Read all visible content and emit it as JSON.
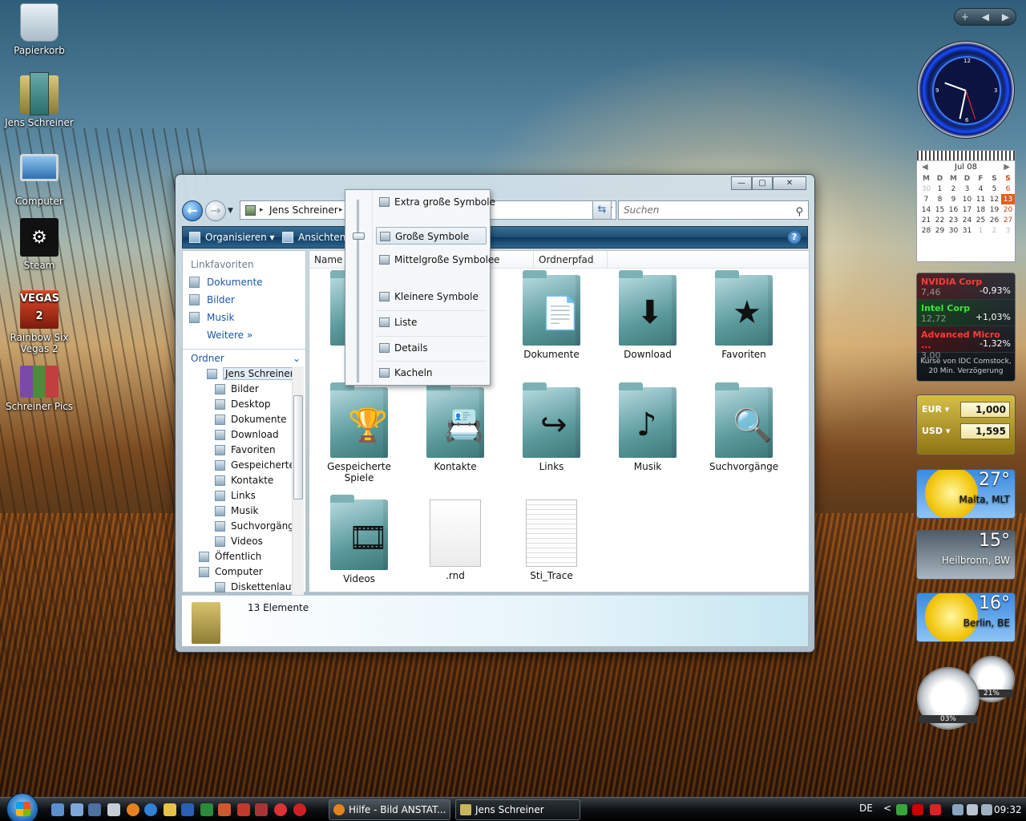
{
  "desktop": {
    "icons": [
      {
        "label": "Papierkorb"
      },
      {
        "label": "Jens Schreiner"
      },
      {
        "label": "Computer"
      },
      {
        "label": "Steam"
      },
      {
        "label": "Rainbow Six Vegas 2"
      },
      {
        "label": "Schreiner Pics"
      }
    ],
    "vegas_logo": "VEGAS 2"
  },
  "explorer": {
    "window_buttons": {
      "min": "—",
      "max": "▢",
      "close": "✕"
    },
    "address": {
      "path": "Jens Schreiner",
      "sep": "▸"
    },
    "search": {
      "placeholder": "Suchen"
    },
    "toolbar": {
      "organize": "Organisieren",
      "views": "Ansichten",
      "help": "?"
    },
    "favorites": {
      "header": "Linkfavoriten",
      "items": [
        "Dokumente",
        "Bilder",
        "Musik"
      ],
      "more": "Weitere"
    },
    "folders": {
      "header": "Ordner",
      "tree": [
        {
          "label": "Jens Schreiner",
          "indent": 0,
          "selected": true
        },
        {
          "label": "Bilder",
          "indent": 1
        },
        {
          "label": "Desktop",
          "indent": 1
        },
        {
          "label": "Dokumente",
          "indent": 1
        },
        {
          "label": "Download",
          "indent": 1
        },
        {
          "label": "Favoriten",
          "indent": 1
        },
        {
          "label": "Gespeicherte S",
          "indent": 1
        },
        {
          "label": "Kontakte",
          "indent": 1
        },
        {
          "label": "Links",
          "indent": 1
        },
        {
          "label": "Musik",
          "indent": 1
        },
        {
          "label": "Suchvorgänge",
          "indent": 1
        },
        {
          "label": "Videos",
          "indent": 1
        },
        {
          "label": "Öffentlich",
          "indent": -1
        },
        {
          "label": "Computer",
          "indent": -1
        },
        {
          "label": "Diskettenlaufw",
          "indent": 1
        }
      ]
    },
    "columns": {
      "name": "Name",
      "partial": "e",
      "path": "Ordnerpfad"
    },
    "items": [
      {
        "label": "B",
        "kind": "folder",
        "emblem": ""
      },
      {
        "label": "Dokumente",
        "kind": "folder",
        "emblem": "📄"
      },
      {
        "label": "Download",
        "kind": "folder",
        "emblem": "⬇"
      },
      {
        "label": "Favoriten",
        "kind": "folder",
        "emblem": "★"
      },
      {
        "label": "Gespeicherte Spiele",
        "kind": "folder",
        "emblem": "🏆"
      },
      {
        "label": "Kontakte",
        "kind": "folder",
        "emblem": "📇"
      },
      {
        "label": "Links",
        "kind": "folder",
        "emblem": "↪"
      },
      {
        "label": "Musik",
        "kind": "folder",
        "emblem": "♪"
      },
      {
        "label": "Suchvorgänge",
        "kind": "folder",
        "emblem": "🔍"
      },
      {
        "label": "Videos",
        "kind": "folder",
        "emblem": "🎞"
      },
      {
        "label": ".rnd",
        "kind": "file"
      },
      {
        "label": "Sti_Trace",
        "kind": "text"
      }
    ],
    "status": {
      "count": "13 Elemente"
    }
  },
  "view_menu": {
    "items": [
      "Extra große Symbole",
      "Große Symbole",
      "Mittelgroße Symbole",
      "Kleinere Symbole",
      "Liste",
      "Details",
      "Kacheln"
    ],
    "selected": "Große Symbole"
  },
  "gadgets": {
    "nav": {
      "add": "+",
      "prev": "◀",
      "next": "▶"
    },
    "calendar": {
      "month": "Jul 08",
      "prev": "◀",
      "next": "▶",
      "weekdays": [
        "M",
        "D",
        "M",
        "D",
        "F",
        "S",
        "S"
      ],
      "weeks": [
        [
          "30",
          "1",
          "2",
          "3",
          "4",
          "5",
          "6"
        ],
        [
          "7",
          "8",
          "9",
          "10",
          "11",
          "12",
          "13"
        ],
        [
          "14",
          "15",
          "16",
          "17",
          "18",
          "19",
          "20"
        ],
        [
          "21",
          "22",
          "23",
          "24",
          "25",
          "26",
          "27"
        ],
        [
          "28",
          "29",
          "30",
          "31",
          "1",
          "2",
          "3"
        ]
      ],
      "today": "13"
    },
    "stocks": {
      "items": [
        {
          "name": "NVIDIA Corp",
          "price": "7,46",
          "change": "-0,93%",
          "trend": "down"
        },
        {
          "name": "Intel Corp",
          "price": "12,72",
          "change": "+1,03%",
          "trend": "up"
        },
        {
          "name": "Advanced Micro ...",
          "price": "3,00",
          "change": "-1,32%",
          "trend": "down"
        }
      ],
      "footer": "Kurse von IDC Comstock, 20 Min. Verzögerung"
    },
    "currency": [
      {
        "code": "EUR",
        "value": "1,000"
      },
      {
        "code": "USD",
        "value": "1,595"
      }
    ],
    "weather": [
      {
        "temp": "27°",
        "location": "Malta, MLT",
        "condition": "sunny"
      },
      {
        "temp": "15°",
        "location": "Heilbronn, BW",
        "condition": "rain"
      },
      {
        "temp": "16°",
        "location": "Berlin, BE",
        "condition": "sunny"
      }
    ],
    "meters": {
      "cpu": "03%",
      "mem": "21%"
    }
  },
  "taskbar": {
    "tasks": [
      {
        "label": "Hilfe - Bild ANSTAT...",
        "active": false
      },
      {
        "label": "Jens Schreiner",
        "active": true
      }
    ],
    "tray": {
      "lang": "DE",
      "time": "09:32",
      "expand": "<"
    }
  },
  "colors": {
    "link_blue": "#1b58a6",
    "toolbar": "#1e4d74",
    "stock_down": "#ff3a3a",
    "stock_up": "#3fe03f",
    "calendar_today": "#e0601a"
  }
}
